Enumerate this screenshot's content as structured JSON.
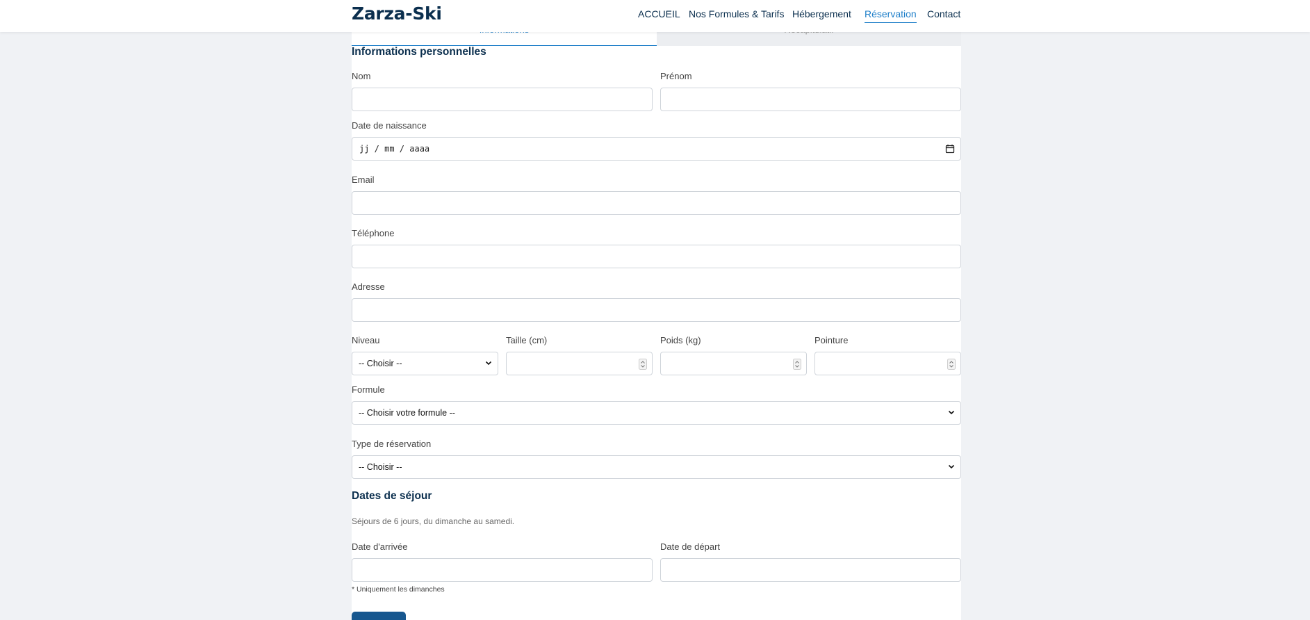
{
  "header": {
    "brand": "Zarza-Ski",
    "nav": [
      "ACCUEIL",
      "Nos Formules & Tarifs",
      "Hébergement",
      "Réservation",
      "Contact"
    ]
  },
  "tabs": [
    "Informations",
    "Récapitulatif"
  ],
  "personal": {
    "title": "Informations personnelles",
    "nom_label": "Nom",
    "prenom_label": "Prénom",
    "dob_label": "Date de naissance",
    "dob_placeholder": "jj / mm / aaaa",
    "email_label": "Email",
    "phone_label": "Téléphone",
    "address_label": "Adresse",
    "niveau_label": "Niveau",
    "niveau_value": "-- Choisir --",
    "taille_label": "Taille (cm)",
    "poids_label": "Poids (kg)",
    "pointure_label": "Pointure",
    "formule_label": "Formule",
    "formule_value": "-- Choisir votre formule --",
    "type_label": "Type de réservation",
    "type_value": "-- Choisir --"
  },
  "stay": {
    "title": "Dates de séjour",
    "hint": "Séjours de 6 jours, du dimanche au samedi.",
    "arrival_label": "Date d'arrivée",
    "departure_label": "Date de départ",
    "note": "* Uniquement les dimanches"
  }
}
